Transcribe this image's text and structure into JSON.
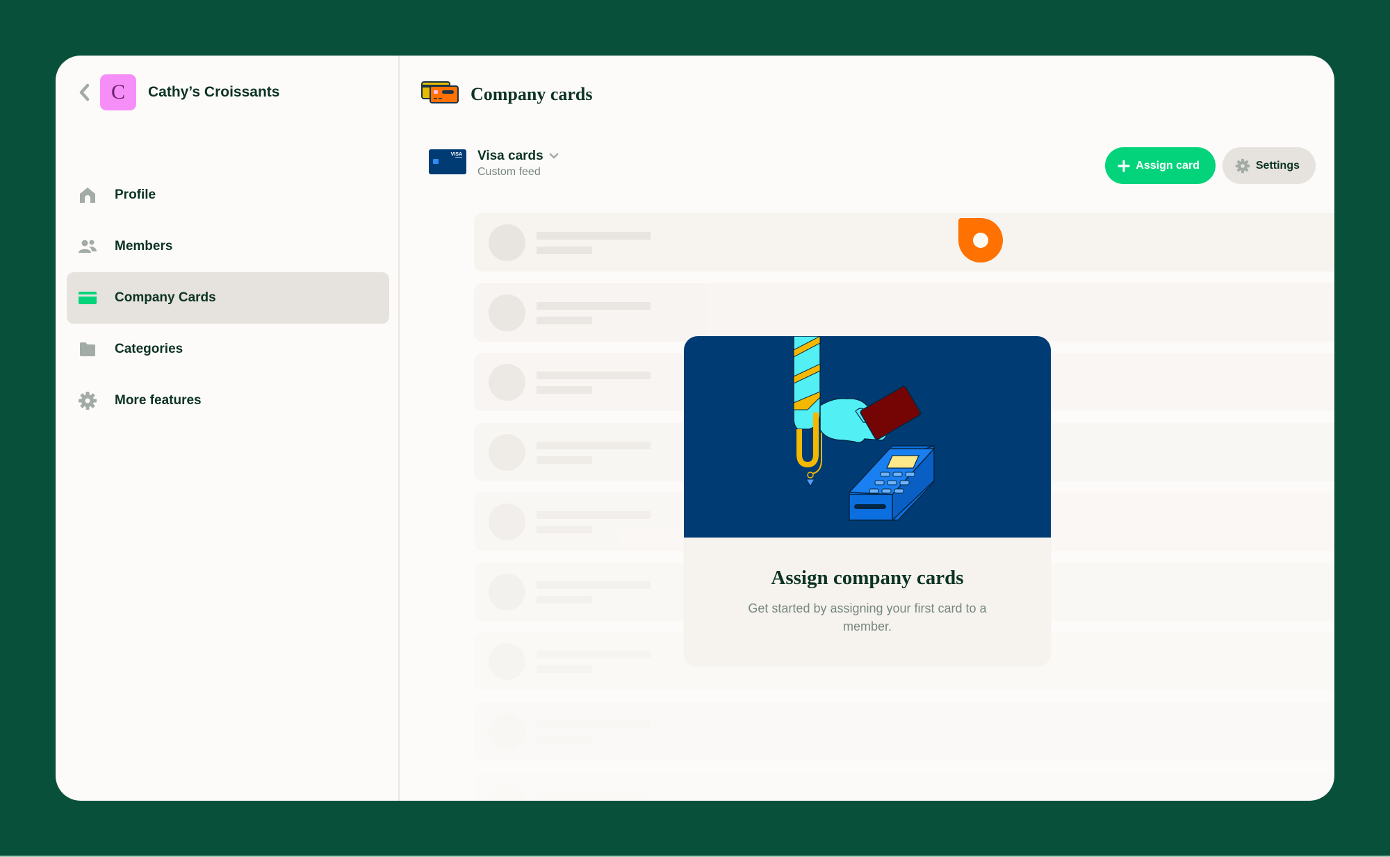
{
  "workspace": {
    "name": "Cathy’s Croissants",
    "avatar_letter": "C",
    "avatar_color": "#f58ff7"
  },
  "sidebar": {
    "items": [
      {
        "label": "Profile",
        "icon": "home-icon",
        "active": false
      },
      {
        "label": "Members",
        "icon": "users-icon",
        "active": false
      },
      {
        "label": "Company Cards",
        "icon": "credit-card-icon",
        "active": true
      },
      {
        "label": "Categories",
        "icon": "folder-icon",
        "active": false
      },
      {
        "label": "More features",
        "icon": "gear-icon",
        "active": false
      }
    ]
  },
  "page": {
    "title": "Company cards",
    "icon": "company-cards-icon"
  },
  "feed": {
    "title": "Visa cards",
    "subtitle": "Custom feed",
    "card_brand": "VISA"
  },
  "actions": {
    "assign_label": "Assign card",
    "settings_label": "Settings"
  },
  "empty_state": {
    "title": "Assign company cards",
    "description": "Get started by assigning your first card to a member."
  },
  "colors": {
    "background": "#08503a",
    "accent_green": "#03d47c",
    "text_dark": "#0c3323",
    "text_muted": "#76877f",
    "illustration_bg": "#003b73",
    "cursor_marker": "#ff7101"
  },
  "skeleton_rows": 9
}
